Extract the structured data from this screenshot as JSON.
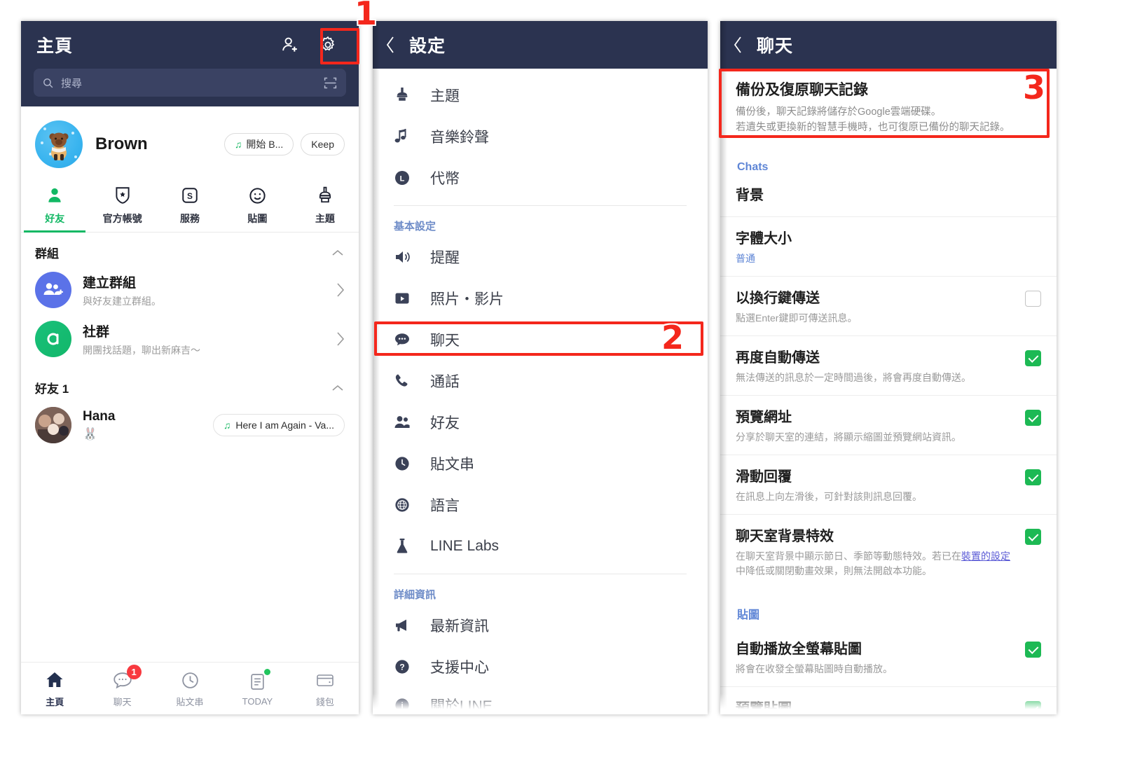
{
  "panel_home": {
    "navbar": {
      "title": "主頁",
      "add_friend_icon": "add-friend-icon",
      "settings_icon": "gear-icon"
    },
    "search": {
      "placeholder": "搜尋",
      "search_icon": "search-icon",
      "scan_icon": "qr-scan-icon"
    },
    "profile": {
      "name": "Brown",
      "music_pill": "開始 B...",
      "keep_pill": "Keep",
      "avatar": "brown-bear-avatar"
    },
    "tabs": [
      {
        "label": "好友",
        "icon": "person-icon",
        "active": true
      },
      {
        "label": "官方帳號",
        "icon": "shield-star-icon",
        "active": false
      },
      {
        "label": "服務",
        "icon": "service-s-icon",
        "active": false
      },
      {
        "label": "貼圖",
        "icon": "smiley-icon",
        "active": false
      },
      {
        "label": "主題",
        "icon": "theme-brush-icon",
        "active": false
      }
    ],
    "sections": [
      {
        "title": "群組",
        "collapse_icon": "chevron-up-icon",
        "items": [
          {
            "title": "建立群組",
            "sub": "與好友建立群組。",
            "avatar": "group-add-icon",
            "chevron": "chevron-right-icon"
          },
          {
            "title": "社群",
            "sub": "開團找話題，聊出新麻吉～",
            "avatar": "openchat-icon",
            "chevron": "chevron-right-icon"
          }
        ]
      },
      {
        "title": "好友 1",
        "collapse_icon": "chevron-up-icon",
        "items": [
          {
            "title": "Hana",
            "sub": "",
            "avatar": "hana-avatar",
            "music": "Here I am Again - Va..."
          }
        ]
      }
    ],
    "tabbar": [
      {
        "label": "主頁",
        "icon": "home-icon",
        "active": true,
        "badge": ""
      },
      {
        "label": "聊天",
        "icon": "chat-bubble-icon",
        "active": false,
        "badge": "1"
      },
      {
        "label": "貼文串",
        "icon": "timeline-clock-icon",
        "active": false,
        "badge": ""
      },
      {
        "label": "TODAY",
        "icon": "today-doc-icon",
        "active": false,
        "badge": "",
        "dot": true
      },
      {
        "label": "錢包",
        "icon": "wallet-icon",
        "active": false,
        "badge": ""
      }
    ]
  },
  "panel_settings": {
    "navbar": {
      "back_icon": "chevron-left-icon",
      "title": "設定"
    },
    "groups": [
      {
        "title": "",
        "items": [
          {
            "label": "主題",
            "icon": "theme-brush-icon"
          },
          {
            "label": "音樂鈴聲",
            "icon": "music-note-icon"
          },
          {
            "label": "代幣",
            "icon": "line-coin-icon"
          }
        ]
      },
      {
        "title": "基本設定",
        "items": [
          {
            "label": "提醒",
            "icon": "speaker-icon"
          },
          {
            "label": "照片・影片",
            "icon": "video-play-icon"
          },
          {
            "label": "聊天",
            "icon": "chat-dots-icon",
            "highlighted": true
          },
          {
            "label": "通話",
            "icon": "phone-icon"
          },
          {
            "label": "好友",
            "icon": "friends-icon"
          },
          {
            "label": "貼文串",
            "icon": "clock-icon"
          },
          {
            "label": "語言",
            "icon": "globe-icon"
          },
          {
            "label": "LINE Labs",
            "icon": "flask-icon"
          }
        ]
      },
      {
        "title": "詳細資訊",
        "items": [
          {
            "label": "最新資訊",
            "icon": "megaphone-icon"
          },
          {
            "label": "支援中心",
            "icon": "question-icon"
          },
          {
            "label": "關於LINE",
            "icon": "info-icon",
            "cutoff": true
          }
        ]
      }
    ]
  },
  "panel_chat_settings": {
    "navbar": {
      "back_icon": "chevron-left-icon",
      "title": "聊天"
    },
    "backup": {
      "title": "備份及復原聊天記錄",
      "desc_line1": "備份後，聊天記錄將儲存於Google雲端硬碟。",
      "desc_line2": "若遺失或更換新的智慧手機時，也可復原已備份的聊天記錄。"
    },
    "group_chats_label": "Chats",
    "chat_rows": [
      {
        "title": "背景",
        "sub": "",
        "control": "none"
      },
      {
        "title": "字體大小",
        "sub": "普通",
        "sub_style": "blue",
        "control": "none"
      },
      {
        "title": "以換行鍵傳送",
        "sub": "點選Enter鍵即可傳送訊息。",
        "control": "checkbox",
        "checked": false
      },
      {
        "title": "再度自動傳送",
        "sub": "無法傳送的訊息於一定時間過後，將會再度自動傳送。",
        "control": "checkbox",
        "checked": true
      },
      {
        "title": "預覽網址",
        "sub": "分享於聊天室的連結，將顯示縮圖並預覽網站資訊。",
        "control": "checkbox",
        "checked": true
      },
      {
        "title": "滑動回覆",
        "sub": "在訊息上向左滑後，可針對該則訊息回覆。",
        "control": "checkbox",
        "checked": true
      },
      {
        "title": "聊天室背景特效",
        "sub": "在聊天室背景中顯示節日、季節等動態特效。若已在裝置的設定中降低或關閉動畫效果，則無法開啟本功能。",
        "sub_link": "裝置的設定",
        "control": "checkbox",
        "checked": true
      }
    ],
    "group_stickers_label": "貼圖",
    "sticker_rows": [
      {
        "title": "自動播放全螢幕貼圖",
        "sub": "將會在收發全螢幕貼圖時自動播放。",
        "control": "checkbox",
        "checked": true
      },
      {
        "title": "預覽貼圖",
        "sub": "",
        "control": "checkbox",
        "checked": true,
        "cutoff": true
      }
    ]
  },
  "annotations": {
    "step1": "1",
    "step2": "2",
    "step3": "3",
    "accent_color": "#f4271c"
  }
}
